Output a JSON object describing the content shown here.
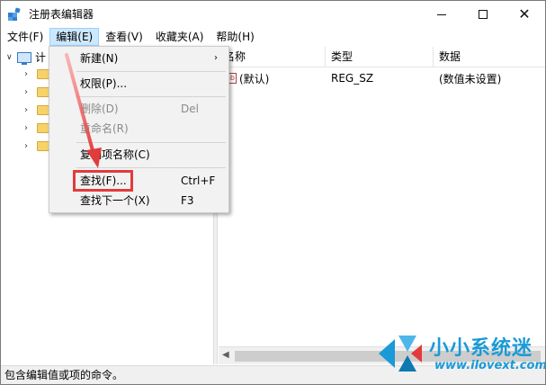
{
  "window": {
    "title": "注册表编辑器"
  },
  "menubar": {
    "items": [
      "文件(F)",
      "编辑(E)",
      "查看(V)",
      "收藏夹(A)",
      "帮助(H)"
    ],
    "active_index": 1
  },
  "tree": {
    "root_label": "计",
    "child_count": 5
  },
  "list": {
    "headers": {
      "name": "名称",
      "type": "类型",
      "data": "数据"
    },
    "rows": [
      {
        "name": "(默认)",
        "type": "REG_SZ",
        "data": "(数值未设置)"
      }
    ]
  },
  "edit_menu": {
    "items": [
      {
        "label": "新建(N)",
        "shortcut": "",
        "submenu": true,
        "disabled": false
      },
      {
        "label": "权限(P)...",
        "shortcut": "",
        "submenu": false,
        "disabled": false
      },
      {
        "label": "删除(D)",
        "shortcut": "Del",
        "submenu": false,
        "disabled": true
      },
      {
        "label": "重命名(R)",
        "shortcut": "",
        "submenu": false,
        "disabled": true
      },
      {
        "label": "复制项名称(C)",
        "shortcut": "",
        "submenu": false,
        "disabled": false
      },
      {
        "label": "查找(F)...",
        "shortcut": "Ctrl+F",
        "submenu": false,
        "disabled": false
      },
      {
        "label": "查找下一个(X)",
        "shortcut": "F3",
        "submenu": false,
        "disabled": false
      }
    ]
  },
  "statusbar": {
    "text": "包含编辑值或项的命令。"
  },
  "watermark": {
    "brand": "小小系统迷",
    "url": "www.ilovext.com"
  },
  "colors": {
    "accent_highlight": "#cce8ff",
    "annotation_red": "#e23b3b",
    "watermark_blue": "#1a9ad6"
  }
}
